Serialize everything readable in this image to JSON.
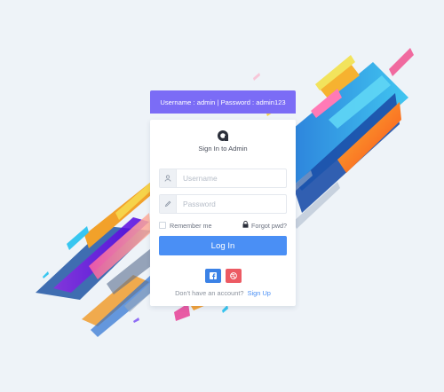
{
  "hint": {
    "text": "Username : admin | Password : admin123"
  },
  "login": {
    "title": "Sign In to Admin",
    "username_placeholder": "Username",
    "password_placeholder": "Password",
    "remember_label": "Remember me",
    "forgot_label": "Forgot pwd?",
    "submit_label": "Log In",
    "no_account_text": "Don't have an account?",
    "signup_label": "Sign Up"
  },
  "icons": {
    "logo": "logo-icon",
    "username": "user-icon",
    "password": "pencil-icon",
    "forgot": "lock-icon",
    "facebook": "facebook-icon",
    "dribbble": "dribbble-icon"
  },
  "colors": {
    "background": "#eef3f8",
    "hint_bar": "#7b6cf6",
    "primary": "#4a8ff5",
    "facebook": "#3b82e6",
    "dribbble": "#ec5a63"
  }
}
